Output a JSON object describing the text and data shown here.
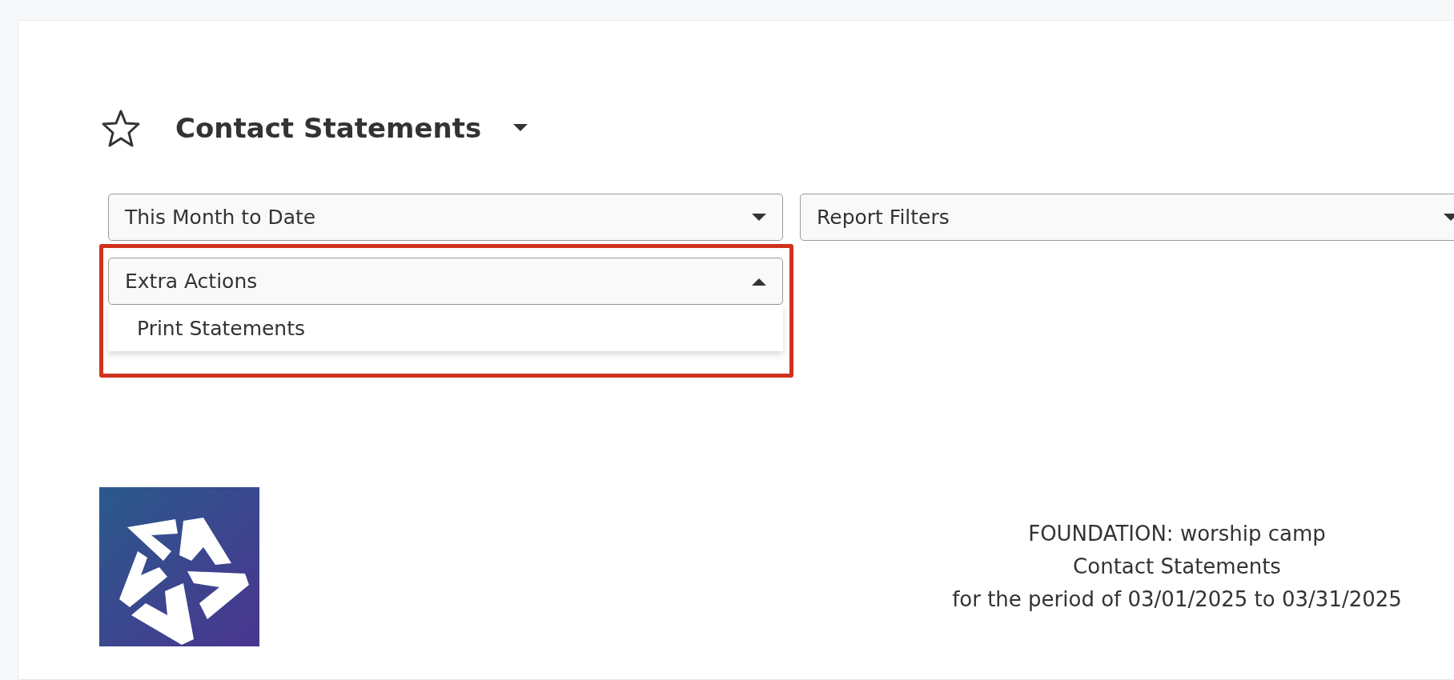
{
  "header": {
    "favorite": false,
    "title": "Contact Statements"
  },
  "controls": [
    {
      "label": "This Month to Date",
      "expanded": false
    },
    {
      "label": "Report Filters",
      "expanded": false
    }
  ],
  "actions": {
    "label": "Extra Actions",
    "expanded": true,
    "items": [
      "Print Statements"
    ]
  },
  "report_header": {
    "lines": [
      "FOUNDATION: worship camp",
      "Contact Statements",
      "for the period of 03/01/2025 to 03/31/2025"
    ]
  }
}
